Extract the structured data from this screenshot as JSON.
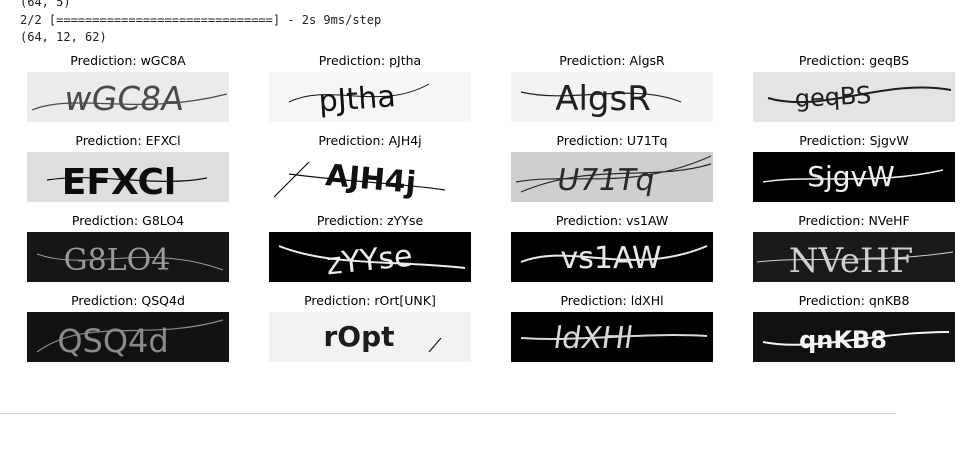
{
  "console": {
    "lines": [
      "(64, 5)",
      "2/2 [==============================] - 2s 9ms/step",
      "(64, 12, 62)"
    ]
  },
  "predictions": [
    {
      "label": "Prediction: wGC8A",
      "captcha_text": "wGC8A",
      "bg": "#ebebeb",
      "fg": "#4a4a4a"
    },
    {
      "label": "Prediction: pJtha",
      "captcha_text": "pJtha",
      "bg": "#f6f6f6",
      "fg": "#111111"
    },
    {
      "label": "Prediction: AlgsR",
      "captcha_text": "AlgsR",
      "bg": "#f3f3f3",
      "fg": "#202020"
    },
    {
      "label": "Prediction: geqBS",
      "captcha_text": "geqBS",
      "bg": "#e4e4e4",
      "fg": "#1e1e1e"
    },
    {
      "label": "Prediction: EFXCl",
      "captcha_text": "EFXCl",
      "bg": "#dedede",
      "fg": "#0c0c0c"
    },
    {
      "label": "Prediction: AJH4j",
      "captcha_text": "AJH4j",
      "bg": "#ffffff",
      "fg": "#111111"
    },
    {
      "label": "Prediction: U71Tq",
      "captcha_text": "U71Tq",
      "bg": "#cfcfcf",
      "fg": "#2a2a2a"
    },
    {
      "label": "Prediction: SjgvW",
      "captcha_text": "SjgvW",
      "bg": "#000000",
      "fg": "#f0f0f0"
    },
    {
      "label": "Prediction: G8LO4",
      "captcha_text": "G8LO4",
      "bg": "#161616",
      "fg": "#9a9a9a"
    },
    {
      "label": "Prediction: zYYse",
      "captcha_text": "zYYse",
      "bg": "#000000",
      "fg": "#ededed"
    },
    {
      "label": "Prediction: vs1AW",
      "captcha_text": "vs1AW",
      "bg": "#000000",
      "fg": "#e8e8e8"
    },
    {
      "label": "Prediction: NVeHF",
      "captcha_text": "NVeHF",
      "bg": "#1a1a1a",
      "fg": "#cfcfcf"
    },
    {
      "label": "Prediction: QSQ4d",
      "captcha_text": "QSQ4d",
      "bg": "#121212",
      "fg": "#8a8a8a"
    },
    {
      "label": "Prediction: rOrt[UNK]",
      "captcha_text": "rOpt",
      "bg": "#f2f2f2",
      "fg": "#1c1c1c"
    },
    {
      "label": "Prediction: ldXHl",
      "captcha_text": "ldXHl",
      "bg": "#000000",
      "fg": "#d8d8d8"
    },
    {
      "label": "Prediction: qnKB8",
      "captcha_text": "qnKB8",
      "bg": "#111111",
      "fg": "#f4f4f4"
    }
  ]
}
